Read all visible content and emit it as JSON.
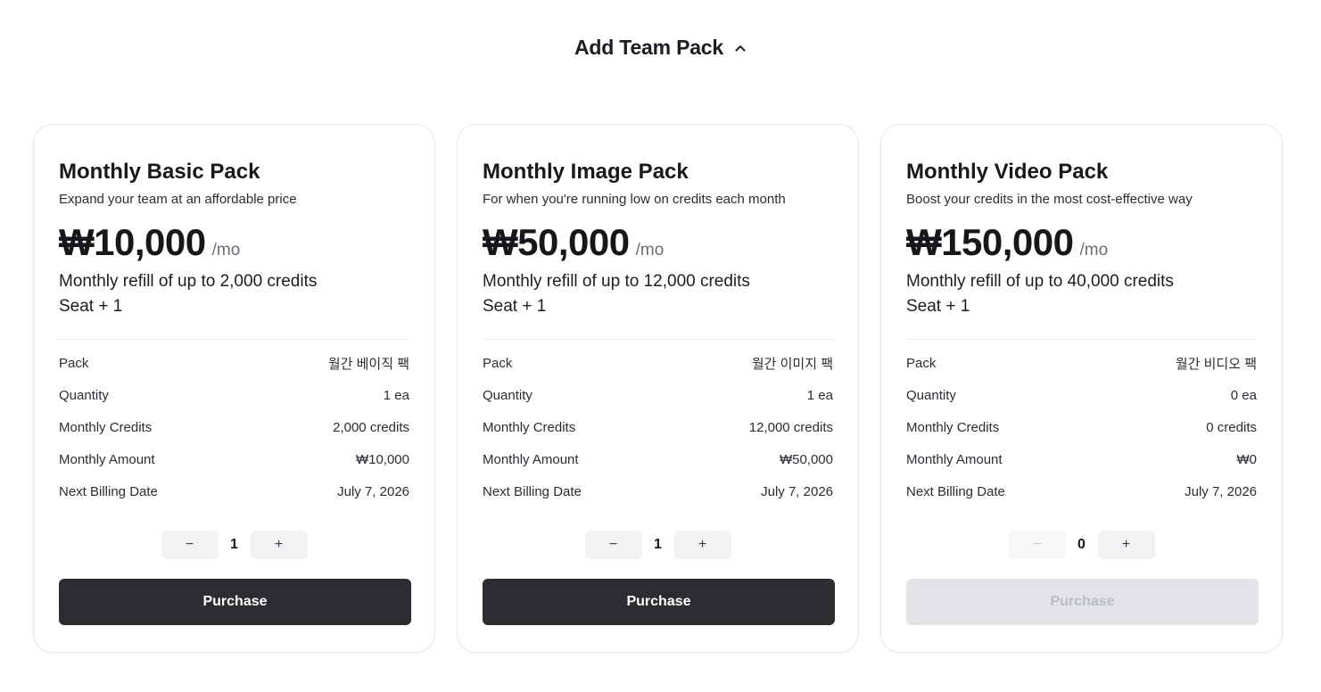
{
  "header": {
    "title": "Add Team Pack",
    "icon": "chevron-up-icon"
  },
  "detail_labels": {
    "pack": "Pack",
    "quantity": "Quantity",
    "monthly_credits": "Monthly Credits",
    "monthly_amount": "Monthly Amount",
    "next_billing_date": "Next Billing Date"
  },
  "stepper": {
    "minus": "−",
    "plus": "+"
  },
  "purchase_label": "Purchase",
  "per_label": "/mo",
  "colors": {
    "button_dark": "#2b2d31",
    "button_disabled": "#e3e4e7",
    "card_border": "#e6e7ea"
  },
  "packs": [
    {
      "title": "Monthly Basic Pack",
      "desc": "Expand your team at an affordable price",
      "price": "₩10,000",
      "refill": "Monthly refill of up to 2,000 credits",
      "seat": "Seat + 1",
      "pack_name": "월간 베이직 팩",
      "quantity": "1 ea",
      "credits": "2,000 credits",
      "amount": "₩10,000",
      "next_billing": "July 7, 2026",
      "qty": "1",
      "minus_disabled": false,
      "purchase_disabled": false
    },
    {
      "title": "Monthly Image Pack",
      "desc": "For when you're running low on credits each month",
      "price": "₩50,000",
      "refill": "Monthly refill of up to 12,000 credits",
      "seat": "Seat + 1",
      "pack_name": "월간 이미지 팩",
      "quantity": "1 ea",
      "credits": "12,000 credits",
      "amount": "₩50,000",
      "next_billing": "July 7, 2026",
      "qty": "1",
      "minus_disabled": false,
      "purchase_disabled": false
    },
    {
      "title": "Monthly Video Pack",
      "desc": "Boost your credits in the most cost-effective way",
      "price": "₩150,000",
      "refill": "Monthly refill of up to 40,000 credits",
      "seat": "Seat + 1",
      "pack_name": "월간 비디오 팩",
      "quantity": "0 ea",
      "credits": "0 credits",
      "amount": "₩0",
      "next_billing": "July 7, 2026",
      "qty": "0",
      "minus_disabled": true,
      "purchase_disabled": true
    }
  ]
}
